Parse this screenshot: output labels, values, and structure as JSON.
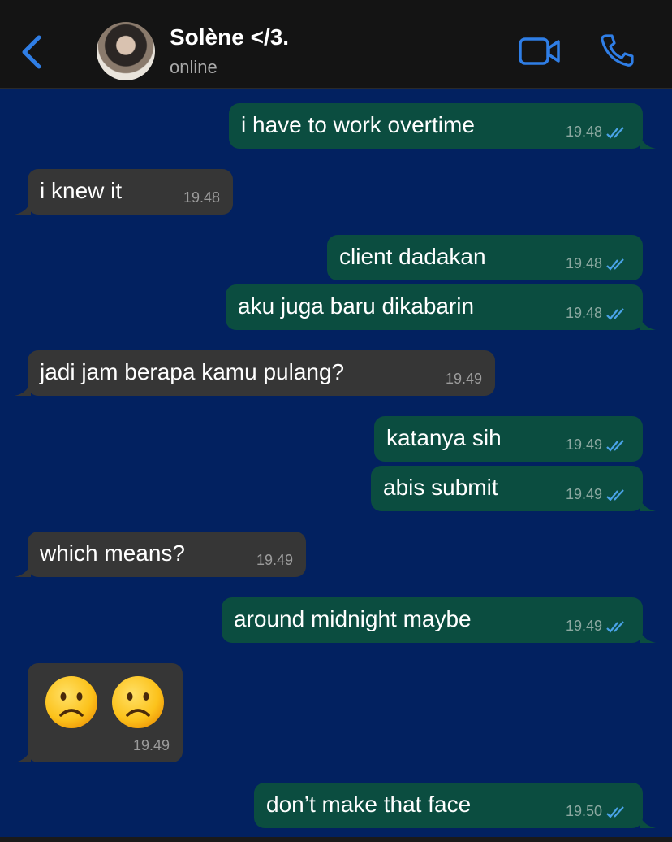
{
  "header": {
    "contact_name": "Solène </3.",
    "status": "online"
  },
  "colors": {
    "background": "#022160",
    "outgoing_bubble": "#0b4d40",
    "incoming_bubble": "#363636",
    "accent": "#2f7ee6",
    "tick_read": "#4aa3e8"
  },
  "messages": [
    {
      "direction": "out",
      "text": "i have to work overtime",
      "time": "19.48",
      "status": "read"
    },
    {
      "direction": "in",
      "text": "i knew it",
      "time": "19.48"
    },
    {
      "direction": "out",
      "text": "client dadakan",
      "time": "19.48",
      "status": "read"
    },
    {
      "direction": "out",
      "text": "aku juga baru dikabarin",
      "time": "19.48",
      "status": "read"
    },
    {
      "direction": "in",
      "text": "jadi jam berapa kamu pulang?",
      "time": "19.49"
    },
    {
      "direction": "out",
      "text": "katanya sih",
      "time": "19.49",
      "status": "read"
    },
    {
      "direction": "out",
      "text": "abis submit",
      "time": "19.49",
      "status": "read"
    },
    {
      "direction": "in",
      "text": "which means?",
      "time": "19.49"
    },
    {
      "direction": "out",
      "text": "around midnight maybe",
      "time": "19.49",
      "status": "read"
    },
    {
      "direction": "in",
      "emoji": [
        "frowning-face",
        "frowning-face"
      ],
      "time": "19.49"
    },
    {
      "direction": "out",
      "text": "don’t make that face",
      "time": "19.50",
      "status": "read"
    }
  ]
}
